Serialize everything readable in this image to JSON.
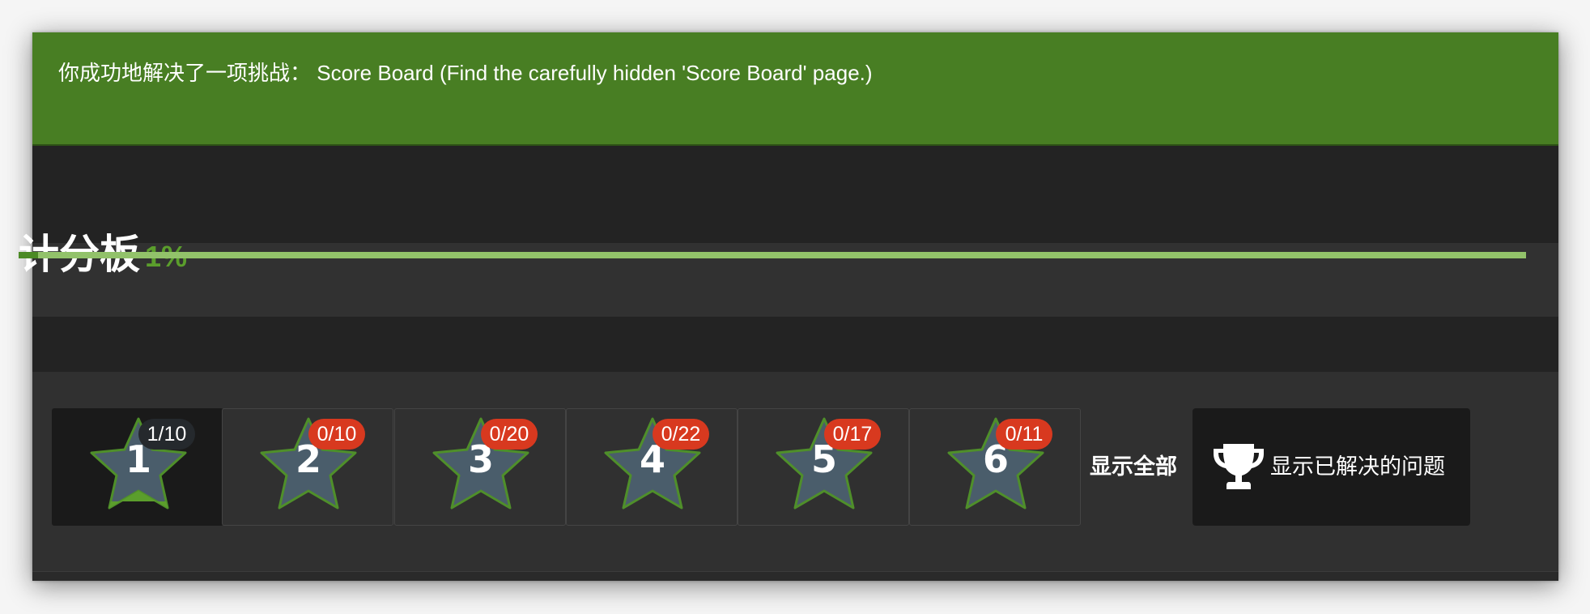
{
  "notification": {
    "message": "你成功地解决了一项挑战： Score Board (Find the carefully hidden 'Score Board' page.)"
  },
  "scoreboard": {
    "title": "计分板",
    "percent_label": "1%",
    "progress_fraction": 0.013
  },
  "difficulty_filters": [
    {
      "level": "1",
      "badge": "1/10",
      "active": true
    },
    {
      "level": "2",
      "badge": "0/10",
      "active": false
    },
    {
      "level": "3",
      "badge": "0/20",
      "active": false
    },
    {
      "level": "4",
      "badge": "0/22",
      "active": false
    },
    {
      "level": "5",
      "badge": "0/17",
      "active": false
    },
    {
      "level": "6",
      "badge": "0/11",
      "active": false
    }
  ],
  "show_all_label": "显示全部",
  "show_solved_label": "显示已解决的问题",
  "icons": {
    "difficulty": "star-icon",
    "solved": "trophy-icon"
  },
  "colors": {
    "banner": "#487e23",
    "accent_green": "#5b9e2c",
    "badge_unsolved": "#d8391f",
    "badge_solved": "#25292d",
    "star_fill": "#4a5d6b",
    "star_border": "#4f8f2a"
  }
}
